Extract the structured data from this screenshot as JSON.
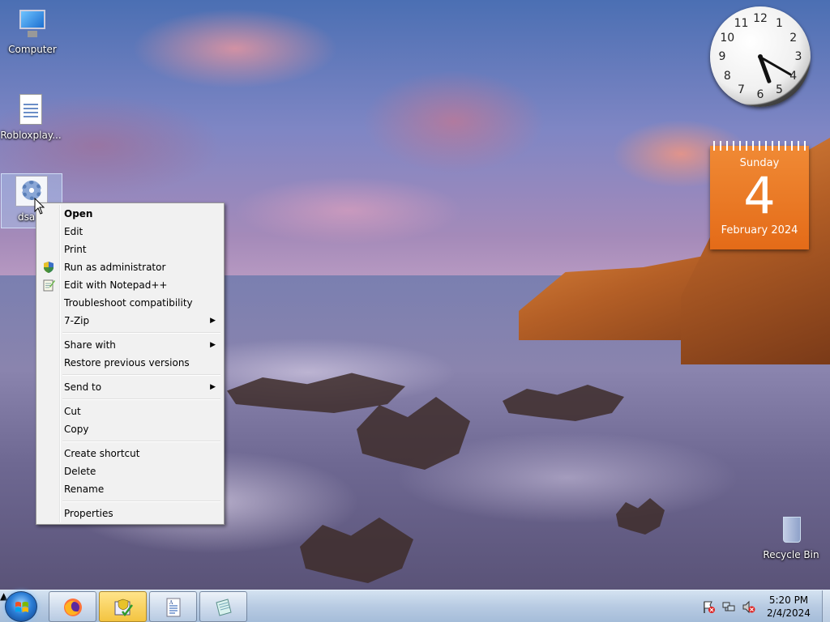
{
  "desktop": {
    "icons": [
      {
        "label": "Computer",
        "icon": "computer-icon"
      },
      {
        "label": "Robloxplay...",
        "icon": "document-icon"
      },
      {
        "label": "dsa",
        "icon": "gear-document-icon",
        "selected": true
      },
      {
        "label": "Recycle Bin",
        "icon": "recycle-bin-icon"
      }
    ]
  },
  "context_menu": {
    "items": {
      "open": "Open",
      "edit": "Edit",
      "print": "Print",
      "run_as_admin": "Run as administrator",
      "edit_notepad": "Edit with Notepad++",
      "troubleshoot": "Troubleshoot compatibility",
      "seven_zip": "7-Zip",
      "share_with": "Share with",
      "restore_versions": "Restore previous versions",
      "send_to": "Send to",
      "cut": "Cut",
      "copy": "Copy",
      "create_shortcut": "Create shortcut",
      "delete": "Delete",
      "rename": "Rename",
      "properties": "Properties"
    }
  },
  "gadgets": {
    "clock": {
      "numbers": [
        "12",
        "1",
        "2",
        "3",
        "4",
        "5",
        "6",
        "7",
        "8",
        "9",
        "10",
        "11"
      ],
      "hour": 5,
      "minute": 20
    },
    "calendar": {
      "weekday": "Sunday",
      "day": "4",
      "month_year": "February 2024"
    }
  },
  "taskbar": {
    "buttons": [
      {
        "name": "firefox",
        "icon": "firefox-icon",
        "active": false
      },
      {
        "name": "installer",
        "icon": "installer-shield-icon",
        "active": true
      },
      {
        "name": "wordpad",
        "icon": "wordpad-icon",
        "active": false
      },
      {
        "name": "notepad",
        "icon": "notepad-icon",
        "active": false
      }
    ],
    "tray": {
      "time": "5:20 PM",
      "date": "2/4/2024"
    }
  },
  "colors": {
    "calendar_orange": "#e46b18",
    "menu_bg": "#f1f1f1",
    "taskbar_active": "#f3c441"
  }
}
